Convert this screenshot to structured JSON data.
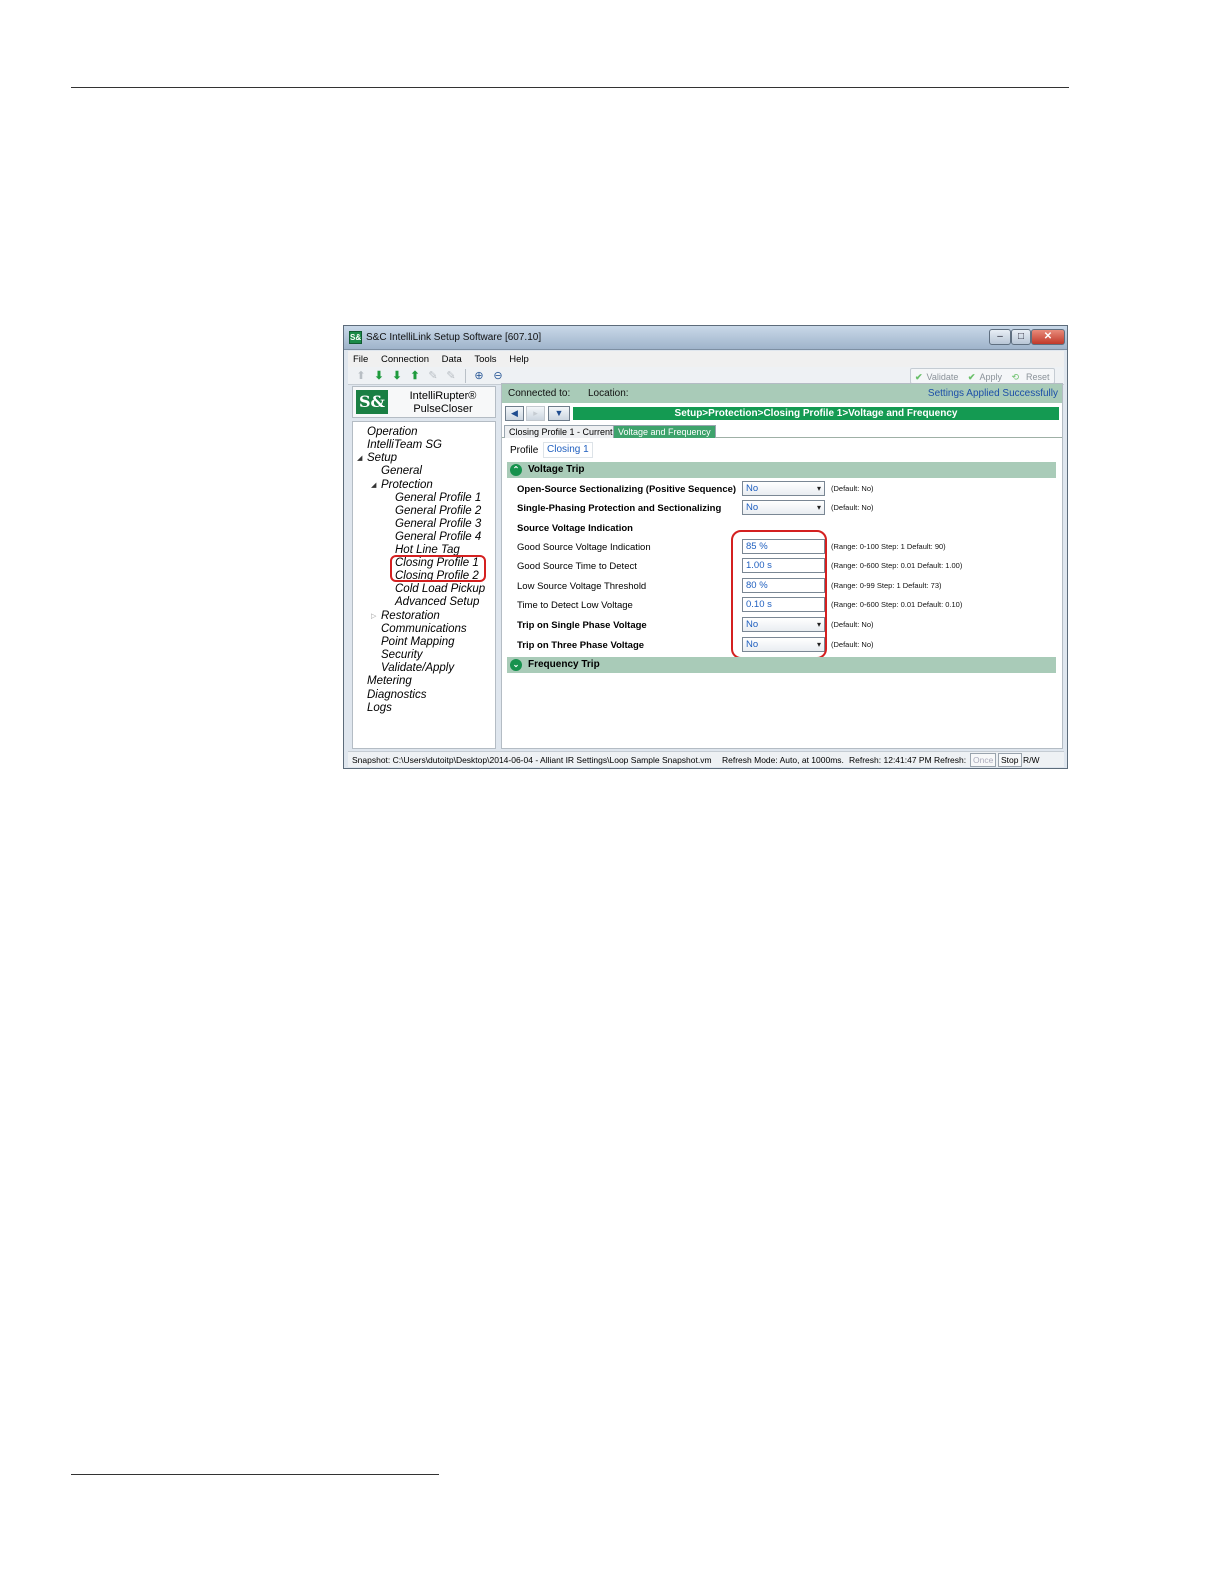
{
  "window": {
    "title": "S&C IntelliLink Setup Software [607.10]",
    "min_glyph": "–",
    "max_glyph": "□",
    "close_glyph": "✕"
  },
  "menu": [
    "File",
    "Connection",
    "Data",
    "Tools",
    "Help"
  ],
  "toolbar": {
    "validate": "Validate",
    "apply": "Apply",
    "reset": "Reset",
    "check_glyph": "✔"
  },
  "logo": {
    "mark": "S&",
    "line1": "IntelliRupter®",
    "line2": "PulseCloser"
  },
  "tree": {
    "items": [
      "Operation",
      "IntelliTeam SG",
      "Setup",
      "General",
      "Protection",
      "General Profile 1",
      "General Profile 2",
      "General Profile 3",
      "General Profile 4",
      "Hot Line Tag",
      "Closing Profile 1",
      "Closing Profile 2",
      "Cold Load Pickup",
      "Advanced Setup",
      "Restoration",
      "Communications",
      "Point Mapping",
      "Security",
      "Validate/Apply",
      "Metering",
      "Diagnostics",
      "Logs"
    ],
    "expanded_glyph": "◢",
    "collapsed_glyph": "▷"
  },
  "status_bar_top": {
    "connected_to": "Connected to:",
    "location": "Location:",
    "message": "Settings Applied Successfully"
  },
  "nav": {
    "back_glyph": "◀",
    "forward_glyph": "▸",
    "down_glyph": "▼"
  },
  "breadcrumb": "Setup>Protection>Closing Profile 1>Voltage and Frequency",
  "tabs": [
    "Closing Profile 1 - Current",
    "Voltage and Frequency"
  ],
  "profile": {
    "label": "Profile",
    "value": "Closing 1"
  },
  "sections": {
    "voltage_trip": "Voltage Trip",
    "frequency_trip": "Frequency Trip",
    "up_glyph": "⌃",
    "down_glyph": "⌄"
  },
  "settings": [
    {
      "label": "Open-Source Sectionalizing (Positive Sequence)",
      "value": "No",
      "hint": "(Default: No)"
    },
    {
      "label": "Single-Phasing Protection and Sectionalizing",
      "value": "No",
      "hint": "(Default: No)"
    },
    {
      "label": "Source Voltage Indication",
      "value": "",
      "hint": ""
    },
    {
      "label": "Good Source Voltage Indication",
      "value": "85 %",
      "hint": "(Range: 0-100 Step: 1 Default: 90)"
    },
    {
      "label": "Good Source Time to Detect",
      "value": "1.00 s",
      "hint": "(Range: 0-600 Step: 0.01 Default: 1.00)"
    },
    {
      "label": "Low Source Voltage Threshold",
      "value": "80 %",
      "hint": "(Range: 0-99 Step: 1 Default: 73)"
    },
    {
      "label": "Time to Detect Low Voltage",
      "value": "0.10 s",
      "hint": "(Range: 0-600 Step: 0.01 Default: 0.10)"
    },
    {
      "label": "Trip on Single Phase Voltage",
      "value": "No",
      "hint": "(Default: No)"
    },
    {
      "label": "Trip on Three Phase Voltage",
      "value": "No",
      "hint": "(Default: No)"
    }
  ],
  "caret_glyph": "▾",
  "statusbar": {
    "snapshot": "Snapshot: C:\\Users\\dutoitp\\Desktop\\2014-06-04 - Alliant IR Settings\\Loop Sample Snapshot.vm",
    "refresh_mode": "Refresh Mode: Auto, at 1000ms.",
    "refresh_time": "Refresh: 12:41:47 PM",
    "refresh_label": "Refresh:",
    "once": "Once",
    "stop": "Stop",
    "rw": "R/W"
  }
}
